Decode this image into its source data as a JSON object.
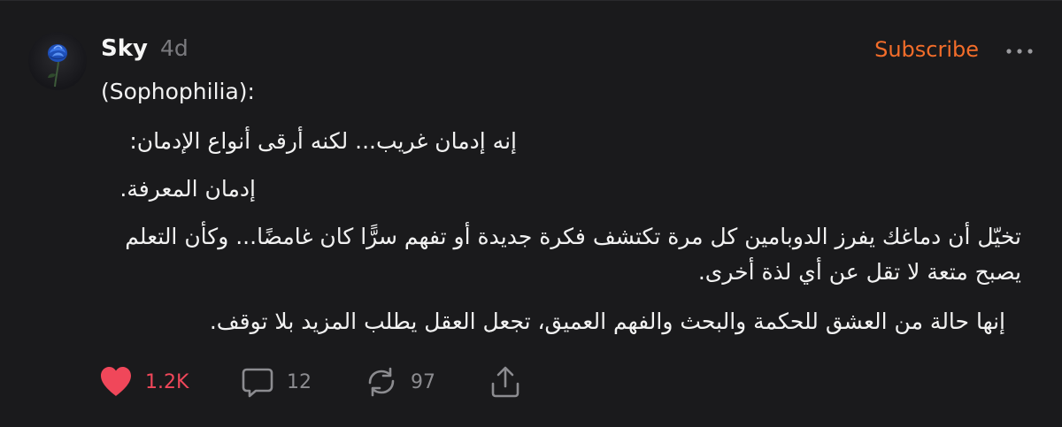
{
  "post": {
    "author": "Sky",
    "time": "4d",
    "subscribe_label": "Subscribe",
    "more_icon": "more-horizontal-icon",
    "lines": {
      "title": "(Sophophilia):",
      "p1": "إنه إدمان غريب... لكنه أرقى أنواع الإدمان:",
      "p2": "إدمان المعرفة.",
      "p3": "تخيّل أن دماغك يفرز الدوبامين كل مرة تكتشف فكرة جديدة أو تفهم سرًّا كان غامضًا... وكأن التعلم يصبح متعة لا تقل عن أي لذة أخرى.",
      "p4": "إنها حالة من العشق للحكمة والبحث والفهم العميق، تجعل العقل يطلب المزيد بلا توقف."
    }
  },
  "actions": {
    "likes": "1.2K",
    "comments": "12",
    "reposts": "97",
    "like_icon": "heart-icon",
    "comment_icon": "comment-icon",
    "repost_icon": "repost-icon",
    "share_icon": "share-icon"
  },
  "colors": {
    "background": "#1a1a1c",
    "accent": "#f36d2a",
    "like": "#f0475a",
    "muted": "#8c8c90"
  }
}
